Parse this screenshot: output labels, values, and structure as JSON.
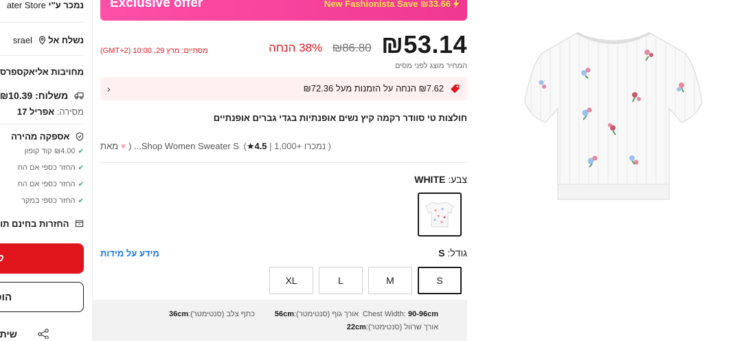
{
  "sidebar": {
    "seller_label": "נמכר ע\"י",
    "seller_name": "ater Store",
    "ship_to_label": "נשלח אל",
    "ship_to_value": "srael",
    "commitment_label": "מחויבות אליאקספרס",
    "shipping_label": "משלוח:",
    "shipping_price": "₪10.39",
    "delivery_label": "מסירה:",
    "delivery_value": "אפריל 17",
    "fast_delivery_label": "אספקה מהירה",
    "perks": [
      "₪4.00 קוד קופון",
      "החזר כספי אם הח",
      "החזר כספי אם הח",
      "החזר כספי במקר"
    ],
    "free_returns_label": "החזרות בחינם תו",
    "buy_now_label": "ק",
    "add_to_cart_label": "הוס",
    "share_label": "שיתוף"
  },
  "offer": {
    "title": "Exclusive offer",
    "save_text": "New Fashionista Save ₪33.66"
  },
  "price": {
    "current": "₪53.14",
    "original": "₪86.80",
    "discount": "38% הנחה",
    "ends_label": "מסתיים:",
    "ends_value": "מרץ 29, 10:00 (GMT+2)",
    "tax_note": "המחיר מוצג לפני מסים"
  },
  "coupon": {
    "text": "₪7.62 הנחה על הזמנות מעל ₪72.36"
  },
  "product": {
    "title": "חולצות טי סוודר רקמה קיץ נשים אופנתיות בגדי גברים אופנתיים",
    "rating": "4.5",
    "rating_text": "| 1,000+ נמכרו )",
    "store_prefix": "מאת",
    "store_name": "Shop Women Sweater S... (",
    "color_label": "צבע:",
    "color_value": "WHITE",
    "size_label": "גודל:",
    "size_value": "S",
    "size_info_link": "מידע על מידות",
    "sizes": [
      "S",
      "M",
      "L",
      "XL"
    ],
    "selected_size": "S"
  },
  "size_chart": {
    "chest_label": "Chest Width:",
    "chest_value": "90-96cm",
    "body_length_label": "אורך גוף (סנטימטר):",
    "body_length_value": "56cm",
    "shoulder_label": "כתף צלב (סנטימטר):",
    "shoulder_value": "36cm",
    "sleeve_label": "אורך שרוול (סנטימטר):",
    "sleeve_value": "22cm"
  },
  "colors": {
    "accent_red": "#e0161c",
    "offer_pink": "#f0388f",
    "offer_yellow": "#ffe24d",
    "link_blue": "#1a73e8"
  }
}
